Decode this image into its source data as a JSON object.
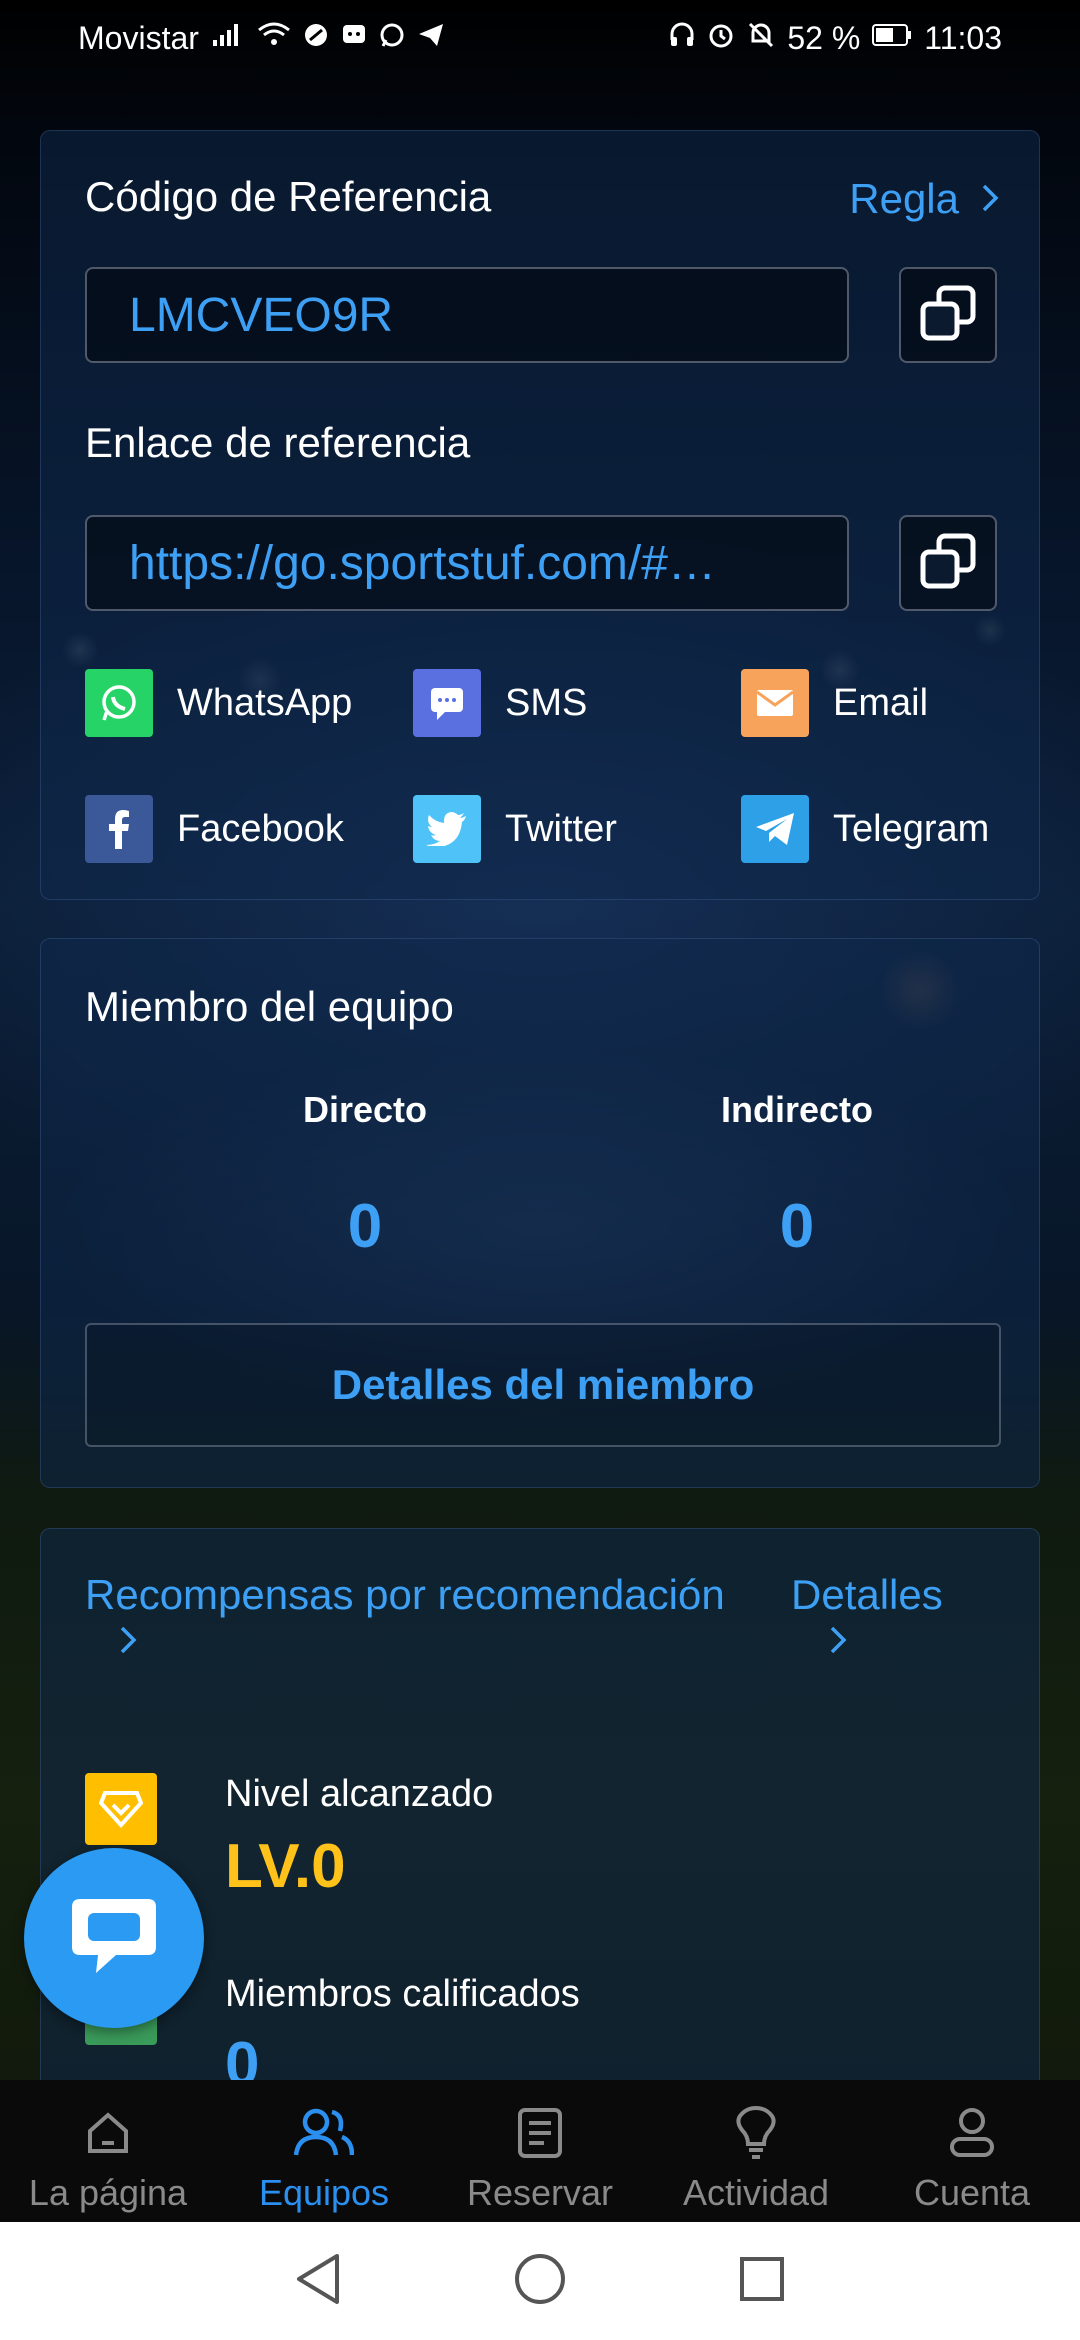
{
  "status_bar": {
    "carrier": "Movistar",
    "battery": "52 %",
    "time": "11:03"
  },
  "referral": {
    "title": "Código de Referencia",
    "rule_label": "Regla",
    "code": "LMCVEO9R",
    "link_label": "Enlace de referencia",
    "link": "https://go.sportstuf.com/#…",
    "share": [
      {
        "label": "WhatsApp",
        "icon": "whatsapp-icon",
        "color": "#25d366"
      },
      {
        "label": "SMS",
        "icon": "sms-icon",
        "color": "#5a6fe0"
      },
      {
        "label": "Email",
        "icon": "email-icon",
        "color": "#f7a35c"
      },
      {
        "label": "Facebook",
        "icon": "facebook-icon",
        "color": "#3b5998"
      },
      {
        "label": "Twitter",
        "icon": "twitter-icon",
        "color": "#4fc3f7"
      },
      {
        "label": "Telegram",
        "icon": "telegram-icon",
        "color": "#2ea0e8"
      }
    ]
  },
  "team": {
    "title": "Miembro del equipo",
    "direct_label": "Directo",
    "direct_value": "0",
    "indirect_label": "Indirecto",
    "indirect_value": "0",
    "details_button": "Detalles del miembro"
  },
  "rewards": {
    "title": "Recompensas por recomendación",
    "details_link": "Detalles",
    "level_label": "Nivel alcanzado",
    "level_value": "LV.0",
    "qualified_label": "Miembros calificados",
    "qualified_value": "0"
  },
  "tabs": [
    {
      "label": "La página",
      "icon": "home-icon",
      "active": false
    },
    {
      "label": "Equipos",
      "icon": "team-icon",
      "active": true
    },
    {
      "label": "Reservar",
      "icon": "document-icon",
      "active": false
    },
    {
      "label": "Actividad",
      "icon": "bulb-icon",
      "active": false
    },
    {
      "label": "Cuenta",
      "icon": "user-icon",
      "active": false
    }
  ],
  "colors": {
    "accent": "#3ea0f5",
    "level": "#ffc21a"
  }
}
